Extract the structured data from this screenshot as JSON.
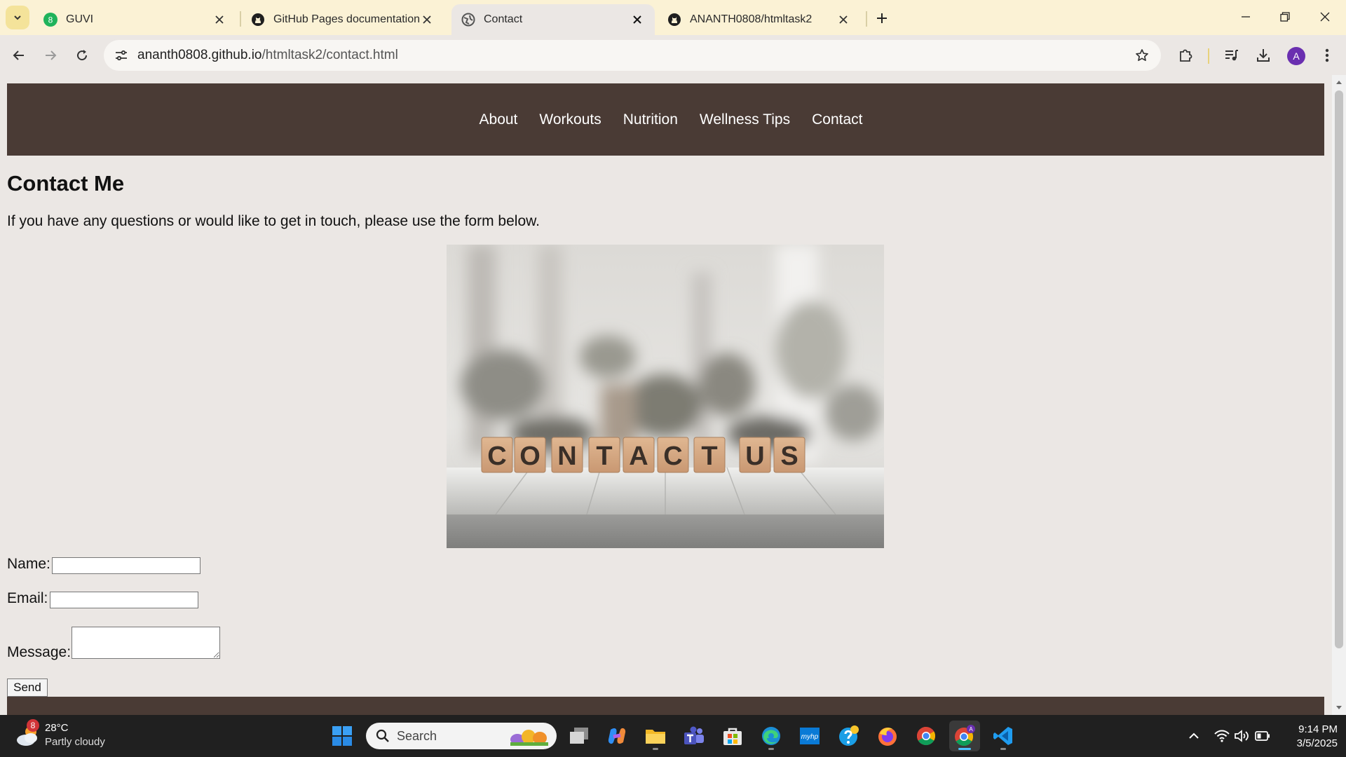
{
  "browser": {
    "tabs": [
      {
        "title": "GUVI",
        "favicon": "guvi-favicon",
        "active": false
      },
      {
        "title": "GitHub Pages documentation -",
        "favicon": "github-icon",
        "active": false
      },
      {
        "title": "Contact",
        "favicon": "globe-icon",
        "active": true
      },
      {
        "title": "ANANTH0808/htmltask2",
        "favicon": "github-icon",
        "active": false
      }
    ],
    "guvi_favicon_text": "8",
    "address": {
      "domain": "ananth0808.github.io",
      "path": "/htmltask2/contact.html"
    },
    "profile_initial": "A",
    "accent_color": "#fbf2d5"
  },
  "page": {
    "nav": [
      "About",
      "Workouts",
      "Nutrition",
      "Wellness Tips",
      "Contact"
    ],
    "heading": "Contact Me",
    "intro": "If you have any questions or would like to get in touch, please use the form below.",
    "hero_image_letters": [
      "C",
      "O",
      "N",
      "T",
      "A",
      "C",
      "T",
      "U",
      "S"
    ],
    "form": {
      "name_label": "Name:",
      "email_label": "Email:",
      "message_label": "Message:",
      "name_value": "",
      "email_value": "",
      "message_value": "",
      "send_label": "Send"
    },
    "header_color": "#4a3b35"
  },
  "taskbar": {
    "weather_badge": "8",
    "temperature": "28°C",
    "condition": "Partly cloudy",
    "search_placeholder": "Search",
    "time": "9:14 PM",
    "date": "3/5/2025"
  }
}
